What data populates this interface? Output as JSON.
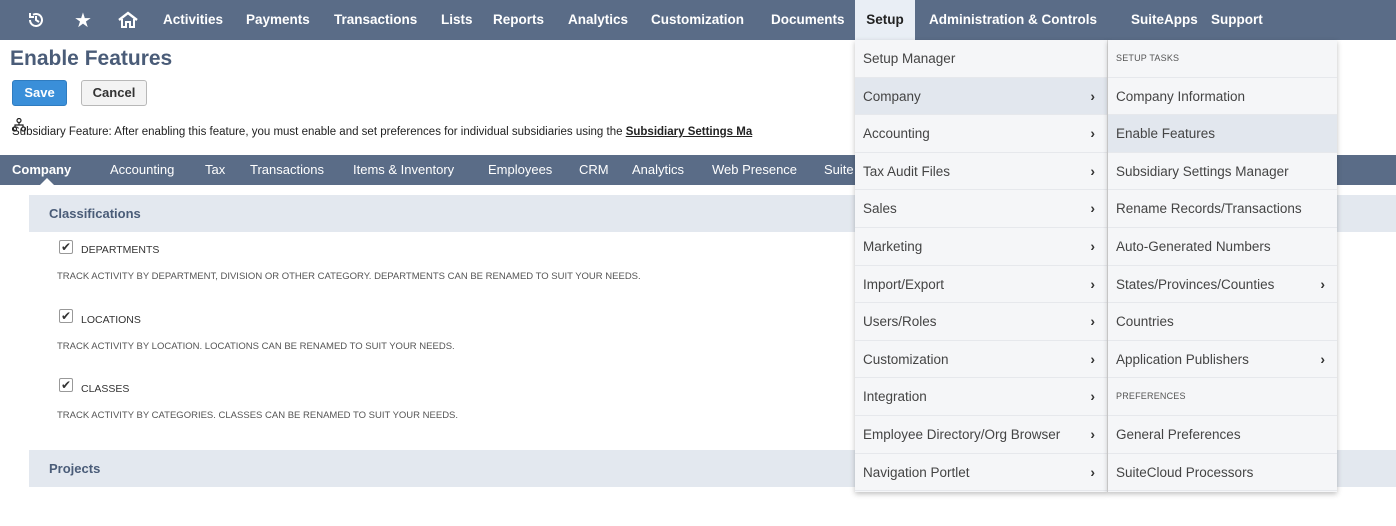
{
  "topnav": {
    "items": [
      "Activities",
      "Payments",
      "Transactions",
      "Lists",
      "Reports",
      "Analytics",
      "Customization",
      "Documents",
      "Setup",
      "Administration & Controls",
      "SuiteApps",
      "Support"
    ]
  },
  "page": {
    "title": "Enable Features",
    "save_label": "Save",
    "cancel_label": "Cancel",
    "notice_text": "Subsidiary Feature: After enabling this feature, you must enable and set preferences for individual subsidiaries using the ",
    "notice_link": "Subsidiary Settings Ma"
  },
  "subtabs": [
    "Company",
    "Accounting",
    "Tax",
    "Transactions",
    "Items & Inventory",
    "Employees",
    "CRM",
    "Analytics",
    "Web Presence",
    "Suite"
  ],
  "sections": {
    "classifications": "Classifications",
    "projects": "Projects"
  },
  "features": [
    {
      "label": "Departments",
      "desc": "Track activity by department, division or other category. Departments can be renamed to suit your needs.",
      "checked": true
    },
    {
      "label": "Locations",
      "desc": "Track activity by location. Locations can be renamed to suit your needs.",
      "checked": true
    },
    {
      "label": "Classes",
      "desc": "Track activity by categories. Classes can be renamed to suit your needs.",
      "checked": true
    }
  ],
  "menu_left": [
    "Setup Manager",
    "Company",
    "Accounting",
    "Tax Audit Files",
    "Sales",
    "Marketing",
    "Import/Export",
    "Users/Roles",
    "Customization",
    "Integration",
    "Employee Directory/Org Browser",
    "Navigation Portlet"
  ],
  "menu_right": [
    "SETUP TASKS",
    "Company Information",
    "Enable Features",
    "Subsidiary Settings Manager",
    "Rename Records/Transactions",
    "Auto-Generated Numbers",
    "States/Provinces/Counties",
    "Countries",
    "Application Publishers",
    "PREFERENCES",
    "General Preferences",
    "SuiteCloud Processors"
  ]
}
